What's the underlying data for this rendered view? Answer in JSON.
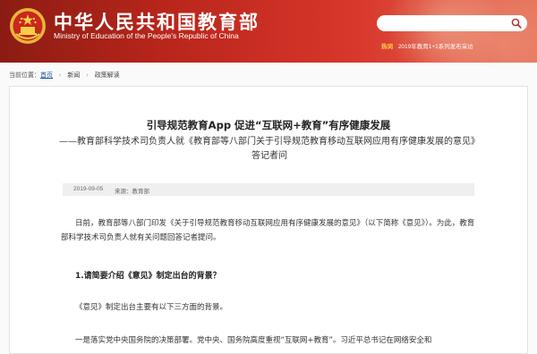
{
  "header": {
    "site_title": "中华人民共和国教育部",
    "site_subtitle": "Ministry of Education of the People's Republic of China",
    "search_placeholder": "",
    "hot_tag": "热词",
    "hot_text": "2019年教育1+1系列发布采访",
    "colors": {
      "primary": "#b8251b",
      "hot": "#ffd24a"
    }
  },
  "breadcrumb": {
    "prefix": "当前位置：",
    "items": [
      "首页",
      "新闻",
      "政策解读"
    ]
  },
  "article": {
    "title": "引导规范教育App 促进“互联网+教育”有序健康发展",
    "subtitle": "——教育部科学技术司负责人就《教育部等八部门关于引导规范教育移动互联网应用有序健康发展的意见》答记者问",
    "date": "2019-09-05",
    "source": "来源：教育部",
    "paragraphs": [
      "日前，教育部等八部门印发《关于引导规范教育移动互联网应用有序健康发展的意见》（以下简称《意见》）。为此，教育部科学技术司负责人就有关问题回答记者提问。",
      "《意见》制定出台主要有以下三方面的背景。",
      "一是落实党中央国务院的决策部署。党中央、国务院高度重视“互联网+教育”。习近平总书记在网络安全和"
    ],
    "section_heading": "1.请简要介绍《意见》制定出台的背景？"
  }
}
